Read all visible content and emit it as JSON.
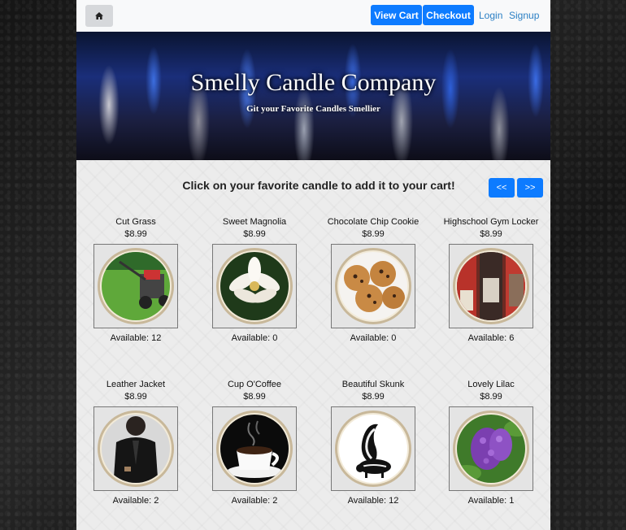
{
  "nav": {
    "home_icon": "home-icon",
    "view_cart": "View Cart",
    "checkout": "Checkout",
    "login": "Login",
    "signup": "Signup"
  },
  "hero": {
    "title": "Smelly Candle Company",
    "subtitle": "Git your Favorite Candles Smellier"
  },
  "main": {
    "instructions": "Click on your favorite candle to add it to your cart!",
    "prev_label": "<<",
    "next_label": ">>"
  },
  "colors": {
    "primary": "#0d7bff",
    "link": "#2a7fc4"
  },
  "products": [
    {
      "name": "Cut Grass",
      "price": "$8.99",
      "available": "Available: 12",
      "icon": "lawnmower-image"
    },
    {
      "name": "Sweet Magnolia",
      "price": "$8.99",
      "available": "Available: 0",
      "icon": "magnolia-image"
    },
    {
      "name": "Chocolate Chip Cookie",
      "price": "$8.99",
      "available": "Available: 0",
      "icon": "cookies-image"
    },
    {
      "name": "Highschool Gym Locker",
      "price": "$8.99",
      "available": "Available: 6",
      "icon": "locker-image"
    },
    {
      "name": "Leather Jacket",
      "price": "$8.99",
      "available": "Available: 2",
      "icon": "leather-jacket-image"
    },
    {
      "name": "Cup O'Coffee",
      "price": "$8.99",
      "available": "Available: 2",
      "icon": "coffee-cup-image"
    },
    {
      "name": "Beautiful Skunk",
      "price": "$8.99",
      "available": "Available: 12",
      "icon": "skunk-image"
    },
    {
      "name": "Lovely Lilac",
      "price": "$8.99",
      "available": "Available: 1",
      "icon": "lilac-image"
    }
  ]
}
